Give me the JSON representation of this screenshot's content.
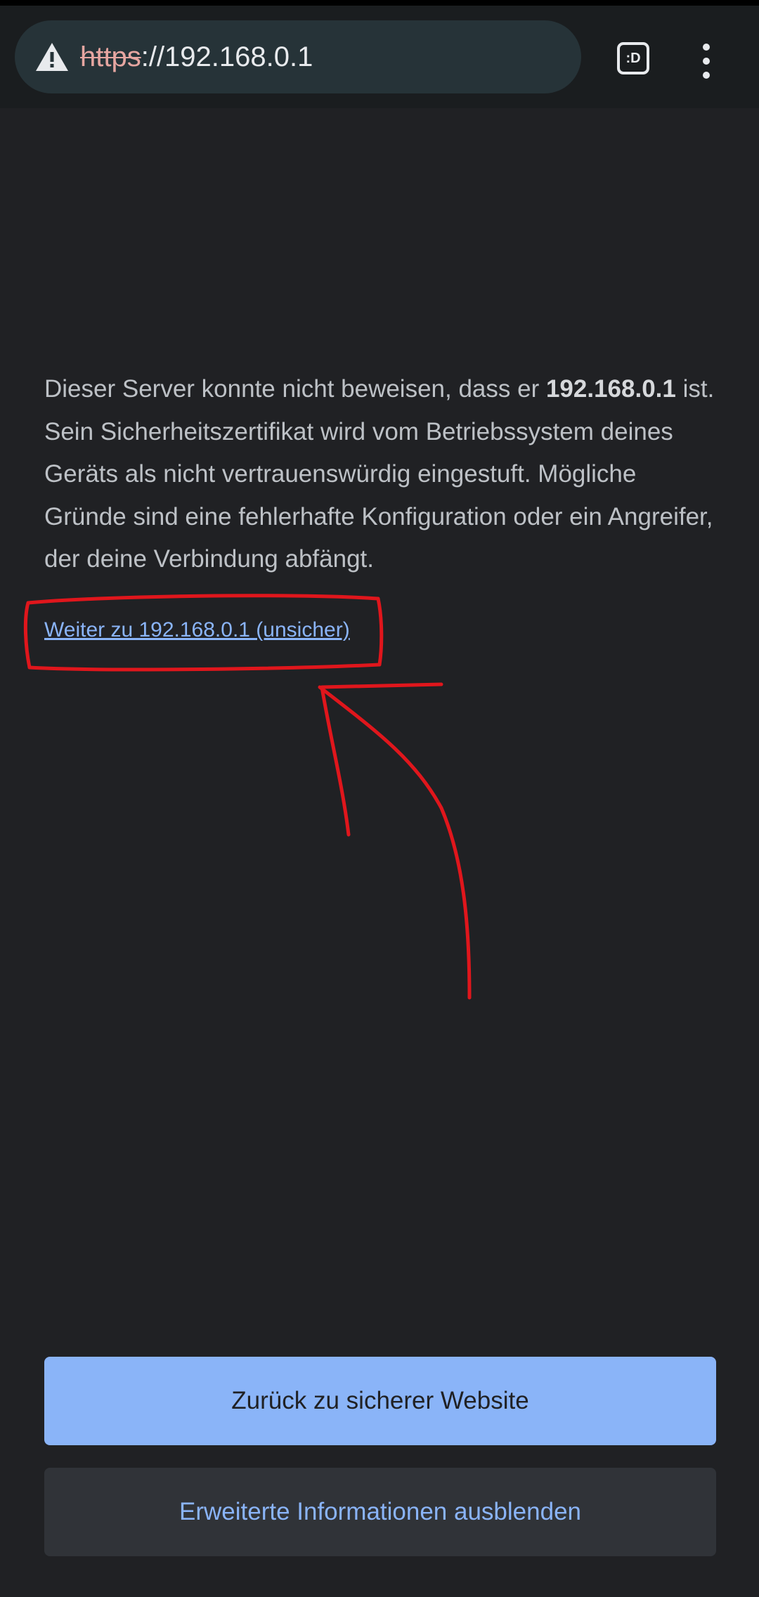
{
  "browser": {
    "url_scheme": "https",
    "url_rest": "://192.168.0.1",
    "tab_switcher_label": ":D",
    "warning_icon": "warning-triangle-icon",
    "menu_icon": "more-vert-icon"
  },
  "interstitial": {
    "text_before_host": "Dieser Server konnte nicht beweisen, dass er ",
    "host": "192.168.0.1",
    "text_after_host": " ist. Sein Sicherheitszertifikat wird vom Betriebssystem deines Geräts als nicht vertrauenswürdig eingestuft. Mögliche Gründe sind eine fehlerhafte Konfiguration oder ein Angreifer, der deine Verbindung abfängt.",
    "proceed_link": "Weiter zu 192.168.0.1 (unsicher)",
    "back_button": "Zurück zu sicherer Website",
    "details_button": "Erweiterte Informationen ausblenden"
  },
  "colors": {
    "background": "#202124",
    "accent": "#8ab4f8",
    "annotation": "#e0161c"
  }
}
